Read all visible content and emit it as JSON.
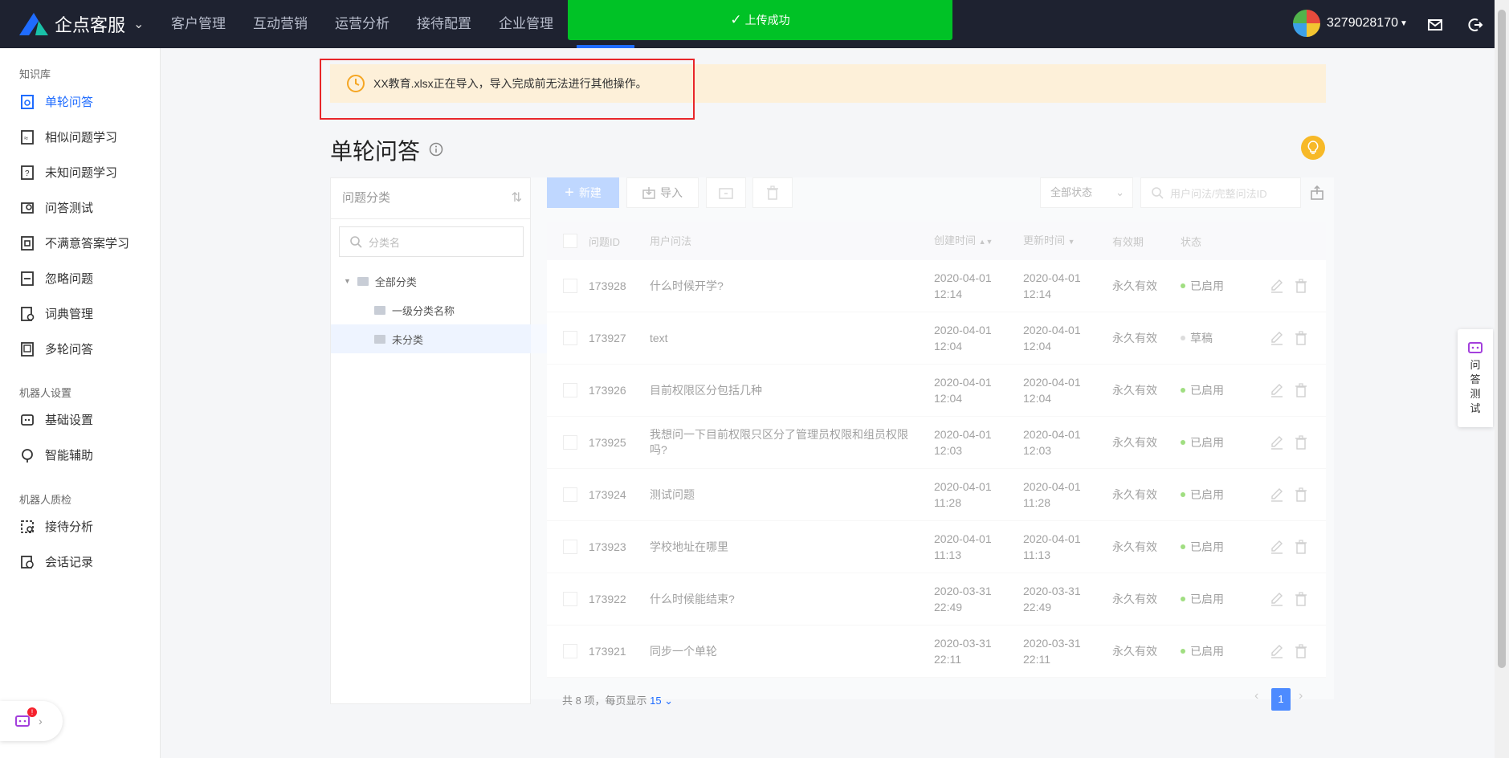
{
  "app": {
    "name": "企点客服"
  },
  "nav": {
    "items": [
      "客户管理",
      "互动营销",
      "运营分析",
      "接待配置",
      "企业管理"
    ]
  },
  "toast": {
    "text": "上传成功"
  },
  "user": {
    "id": "3279028170"
  },
  "sidebar": {
    "groups": [
      {
        "title": "知识库",
        "items": [
          "单轮问答",
          "相似问题学习",
          "未知问题学习",
          "问答测试",
          "不满意答案学习",
          "忽略问题",
          "词典管理",
          "多轮问答"
        ]
      },
      {
        "title": "机器人设置",
        "items": [
          "基础设置",
          "智能辅助"
        ]
      },
      {
        "title": "机器人质检",
        "items": [
          "接待分析",
          "会话记录"
        ]
      }
    ],
    "badge": "!"
  },
  "notice": {
    "text": "XX教育.xlsx正在导入，导入完成前无法进行其他操作。"
  },
  "page": {
    "title": "单轮问答"
  },
  "category": {
    "header": "问题分类",
    "search_placeholder": "分类名",
    "tree": [
      "全部分类",
      "一级分类名称",
      "未分类"
    ]
  },
  "toolbar": {
    "new_label": "新建",
    "import_label": "导入",
    "status_select": "全部状态",
    "search_placeholder": "用户问法/完整问法ID"
  },
  "table": {
    "headers": {
      "id": "问题ID",
      "question": "用户问法",
      "created": "创建时间",
      "updated": "更新时间",
      "expiry": "有效期",
      "status": "状态"
    },
    "rows": [
      {
        "id": "173928",
        "q": "什么时候开学?",
        "c1": "2020-04-01",
        "c2": "12:14",
        "u1": "2020-04-01",
        "u2": "12:14",
        "exp": "永久有效",
        "st": "已启用"
      },
      {
        "id": "173927",
        "q": "text",
        "c1": "2020-04-01",
        "c2": "12:04",
        "u1": "2020-04-01",
        "u2": "12:04",
        "exp": "永久有效",
        "st": "草稿"
      },
      {
        "id": "173926",
        "q": "目前权限区分包括几种",
        "c1": "2020-04-01",
        "c2": "12:04",
        "u1": "2020-04-01",
        "u2": "12:04",
        "exp": "永久有效",
        "st": "已启用"
      },
      {
        "id": "173925",
        "q": "我想问一下目前权限只区分了管理员权限和组员权限吗?",
        "c1": "2020-04-01",
        "c2": "12:03",
        "u1": "2020-04-01",
        "u2": "12:03",
        "exp": "永久有效",
        "st": "已启用"
      },
      {
        "id": "173924",
        "q": "测试问题",
        "c1": "2020-04-01",
        "c2": "11:28",
        "u1": "2020-04-01",
        "u2": "11:28",
        "exp": "永久有效",
        "st": "已启用"
      },
      {
        "id": "173923",
        "q": "学校地址在哪里",
        "c1": "2020-04-01",
        "c2": "11:13",
        "u1": "2020-04-01",
        "u2": "11:13",
        "exp": "永久有效",
        "st": "已启用"
      },
      {
        "id": "173922",
        "q": "什么时候能结束?",
        "c1": "2020-03-31",
        "c2": "22:49",
        "u1": "2020-03-31",
        "u2": "22:49",
        "exp": "永久有效",
        "st": "已启用"
      },
      {
        "id": "173921",
        "q": "同步一个单轮",
        "c1": "2020-03-31",
        "c2": "22:11",
        "u1": "2020-03-31",
        "u2": "22:11",
        "exp": "永久有效",
        "st": "已启用"
      }
    ]
  },
  "pagination": {
    "total_text": "共 8 项，每页显示",
    "page_size": "15",
    "current": "1"
  },
  "float_test": {
    "label": "问答测试"
  },
  "colors": {
    "primary": "#1f6cff",
    "toast": "#00c226",
    "enabled": "#52c41a",
    "draft": "#bfbfbf",
    "notice_bg": "#fdf0d9"
  }
}
